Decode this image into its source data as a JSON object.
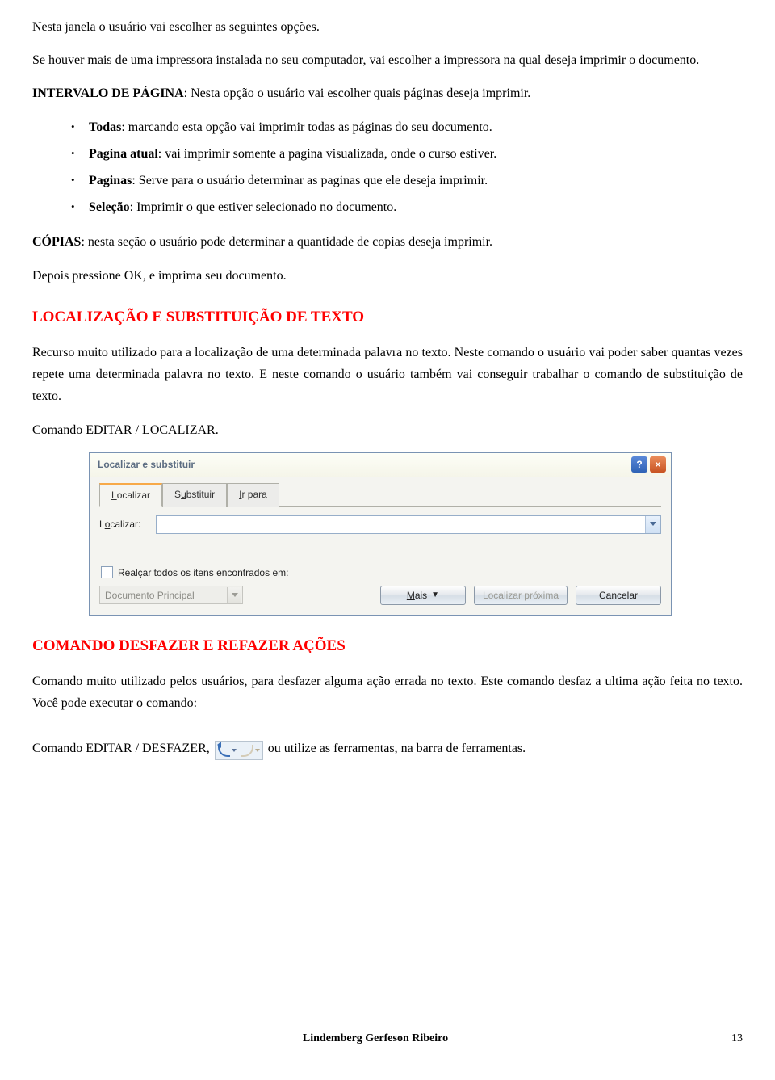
{
  "para1": "Nesta janela o usuário vai escolher as seguintes opções.",
  "para2": "Se houver mais de uma impressora instalada no seu computador, vai escolher a impressora na qual deseja imprimir o documento.",
  "intervalo_label": "INTERVALO DE PÁGINA",
  "intervalo_desc": ": Nesta opção o usuário vai escolher quais páginas deseja imprimir.",
  "bullets": [
    {
      "b": "Todas",
      "t": ": marcando esta opção vai imprimir todas as páginas do seu documento."
    },
    {
      "b": "Pagina atual",
      "t": ": vai imprimir somente a pagina visualizada, onde o curso estiver."
    },
    {
      "b": "Paginas",
      "t": ": Serve para o usuário determinar as paginas que ele deseja imprimir."
    },
    {
      "b": "Seleção",
      "t": ": Imprimir o que estiver selecionado no documento."
    }
  ],
  "copias_label": "CÓPIAS",
  "copias_desc": ": nesta seção o usuário pode determinar a quantidade de copias deseja imprimir.",
  "copias_after": "Depois pressione OK, e imprima seu documento.",
  "heading1": "LOCALIZAÇÃO E SUBSTITUIÇÃO DE TEXTO",
  "loc_para": "Recurso muito utilizado para a localização de uma determinada palavra no texto. Neste comando o usuário vai poder saber quantas vezes repete uma determinada palavra no texto. E neste comando o usuário também vai conseguir trabalhar o comando de substituição de texto.",
  "cmd_editar_localizar": "Comando EDITAR / LOCALIZAR.",
  "dialog": {
    "title": "Localizar e substituir",
    "tabs": {
      "localizar": "Localizar",
      "substituir": "Substituir",
      "irpara": "Ir para"
    },
    "label_localizar": "Localizar:",
    "chk_label": "Realçar todos os itens encontrados em:",
    "doc_principal": "Documento Principal",
    "btn_mais": "Mais",
    "btn_proxima": "Localizar próxima",
    "btn_cancelar": "Cancelar"
  },
  "heading2": "COMANDO DESFAZER E REFAZER AÇÕES",
  "desfazer_para": "Comando muito utilizado pelos usuários, para desfazer alguma ação errada no texto. Este comando desfaz a ultima ação feita no texto. Você pode executar o comando:",
  "cmd_desfazer_pre": "Comando EDITAR / DESFAZER, ",
  "cmd_desfazer_post": " ou utilize as ferramentas, na barra de ferramentas.",
  "footer": {
    "author": "Lindemberg Gerfeson Ribeiro",
    "page": "13"
  }
}
